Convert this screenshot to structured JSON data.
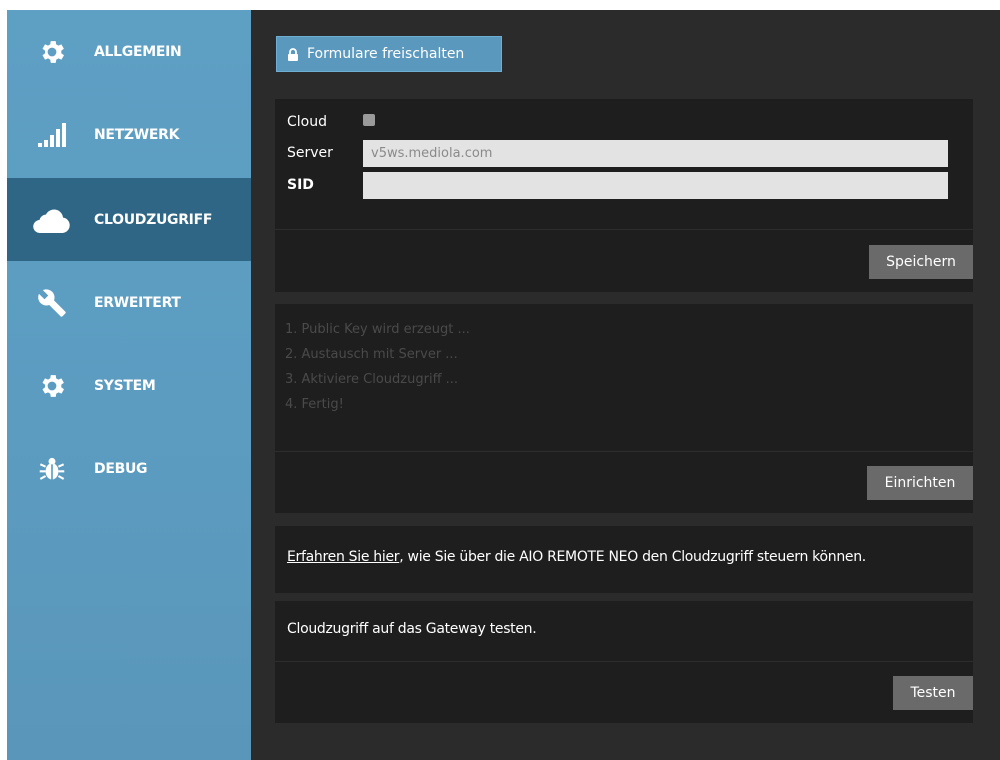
{
  "sidebar": {
    "items": [
      {
        "label": "ALLGEMEIN",
        "icon": "gear-icon"
      },
      {
        "label": "NETZWERK",
        "icon": "signal-icon"
      },
      {
        "label": "CLOUDZUGRIFF",
        "icon": "cloud-icon",
        "active": true
      },
      {
        "label": "ERWEITERT",
        "icon": "wrench-icon"
      },
      {
        "label": "SYSTEM",
        "icon": "gear-icon"
      },
      {
        "label": "DEBUG",
        "icon": "bug-icon"
      }
    ]
  },
  "toolbar": {
    "unlock_label": "Formulare freischalten",
    "unlock_icon": "lock-icon"
  },
  "cloud_form": {
    "cloud_label": "Cloud",
    "cloud_checked": false,
    "server_label": "Server",
    "server_value": "v5ws.mediola.com",
    "sid_label": "SID",
    "sid_value": "",
    "save_label": "Speichern"
  },
  "setup": {
    "steps": [
      "1. Public Key wird erzeugt ...",
      "2. Austausch mit Server ...",
      "3. Aktiviere Cloudzugriff ...",
      "4. Fertig!"
    ],
    "setup_label": "Einrichten"
  },
  "info": {
    "link_text": "Erfahren Sie hier",
    "rest_text": ", wie Sie über die AIO REMOTE NEO den Cloudzugriff steuern können."
  },
  "test": {
    "text": "Cloudzugriff auf das Gateway testen.",
    "button_label": "Testen"
  },
  "colors": {
    "sidebar": "#5e9fc4",
    "sidebar_active": "#2f6685",
    "accent_button": "#5b98bd",
    "panel": "#1e1e1e",
    "background": "#2b2b2b"
  }
}
